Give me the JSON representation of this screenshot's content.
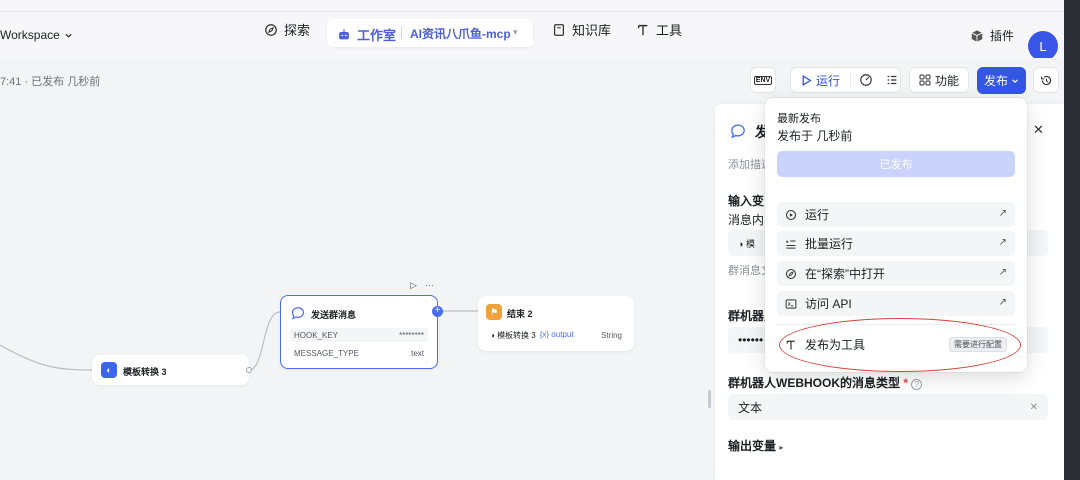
{
  "header": {
    "workspace": "Workspace",
    "nav_explore": "探索",
    "nav_studio": "工作室",
    "project_name": "AI资讯八爪鱼-mcp",
    "nav_knowledge": "知识库",
    "nav_tools": "工具",
    "plugin": "插件",
    "avatar_initial": "L"
  },
  "toolbar": {
    "status": "7:41 · 已发布 几秒前",
    "env": "ENV",
    "run": "运行",
    "features": "功能",
    "publish": "发布"
  },
  "nodes": {
    "template": {
      "title": "模板转换 3"
    },
    "send": {
      "title": "发送群消息",
      "rows": [
        {
          "key": "HOOK_KEY",
          "value": "********"
        },
        {
          "key": "MESSAGE_TYPE",
          "value": "text"
        }
      ]
    },
    "end": {
      "title": "结束 2",
      "source": "模板转换 3",
      "var": "{x} output",
      "type": "String"
    }
  },
  "panel": {
    "title_fragment": "发",
    "desc_fragment": "添加描述",
    "input_vars": "输入变",
    "msg_content": "消息内",
    "msg_tag": "模",
    "group_msg": "群消息文",
    "robot": "群机器人",
    "masked": "••••••",
    "webhook_type_label": "群机器人WEBHOOK的消息类型",
    "webhook_type_value": "文本",
    "output_vars": "输出变量"
  },
  "dropdown": {
    "latest": "最新发布",
    "published_at": "发布于 几秒前",
    "primary_btn": "已发布",
    "items": [
      {
        "label": "运行",
        "icon": "play-circle-icon"
      },
      {
        "label": "批量运行",
        "icon": "batch-run-icon"
      },
      {
        "label": "在“探索”中打开",
        "icon": "explore-icon"
      },
      {
        "label": "访问 API",
        "icon": "terminal-icon"
      }
    ],
    "publish_tool": "发布为工具",
    "publish_tool_badge": "需要进行配置"
  },
  "colors": {
    "accent": "#3356e5",
    "annotation_red": "#d6453d"
  }
}
